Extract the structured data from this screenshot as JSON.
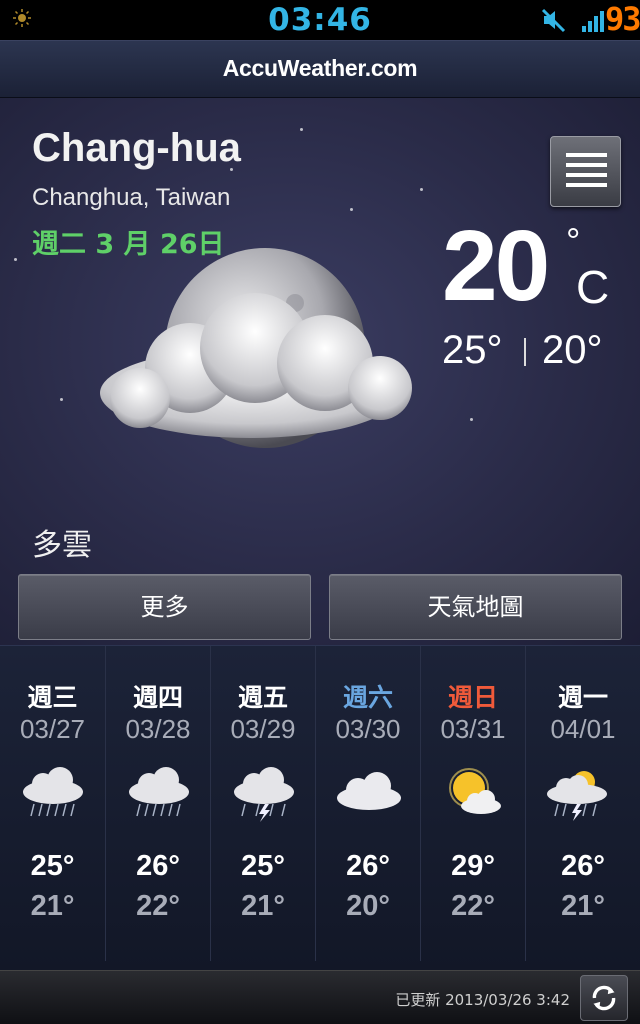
{
  "status_bar": {
    "time": "03:46",
    "battery": "93",
    "icons": [
      "sun-icon",
      "mute-icon",
      "signal-icon"
    ]
  },
  "header": {
    "brand": "AccuWeather.com"
  },
  "current": {
    "city": "Chang-hua",
    "region": "Changhua, Taiwan",
    "date": "週二 3 月 26日",
    "temp": "20",
    "degree_symbol": "°",
    "unit": "C",
    "high": "25°",
    "low": "20°",
    "condition": "多雲",
    "icon": "moon-cloud-icon"
  },
  "buttons": {
    "more": "更多",
    "map": "天氣地圖"
  },
  "forecast": [
    {
      "day": "週三",
      "date": "03/27",
      "high": "25°",
      "low": "21°",
      "icon": "rain-cloud-icon",
      "color": "#ffffff"
    },
    {
      "day": "週四",
      "date": "03/28",
      "high": "26°",
      "low": "22°",
      "icon": "rain-cloud-icon",
      "color": "#ffffff"
    },
    {
      "day": "週五",
      "date": "03/29",
      "high": "25°",
      "low": "21°",
      "icon": "thunderstorm-icon",
      "color": "#ffffff"
    },
    {
      "day": "週六",
      "date": "03/30",
      "high": "26°",
      "low": "20°",
      "icon": "cloud-icon",
      "color": "#6aa6e0"
    },
    {
      "day": "週日",
      "date": "03/31",
      "high": "29°",
      "low": "22°",
      "icon": "sun-cloud-icon",
      "color": "#f05a3a"
    },
    {
      "day": "週一",
      "date": "04/01",
      "high": "26°",
      "low": "21°",
      "icon": "sun-rain-icon",
      "color": "#ffffff"
    }
  ],
  "footer": {
    "updated": "已更新 2013/03/26 3:42",
    "refresh_icon": "refresh-icon"
  },
  "colors": {
    "accent_blue": "#33b5e5",
    "battery_orange": "#ff7a00",
    "date_green": "#5fd068",
    "saturday_blue": "#6aa6e0",
    "sunday_red": "#f05a3a"
  }
}
